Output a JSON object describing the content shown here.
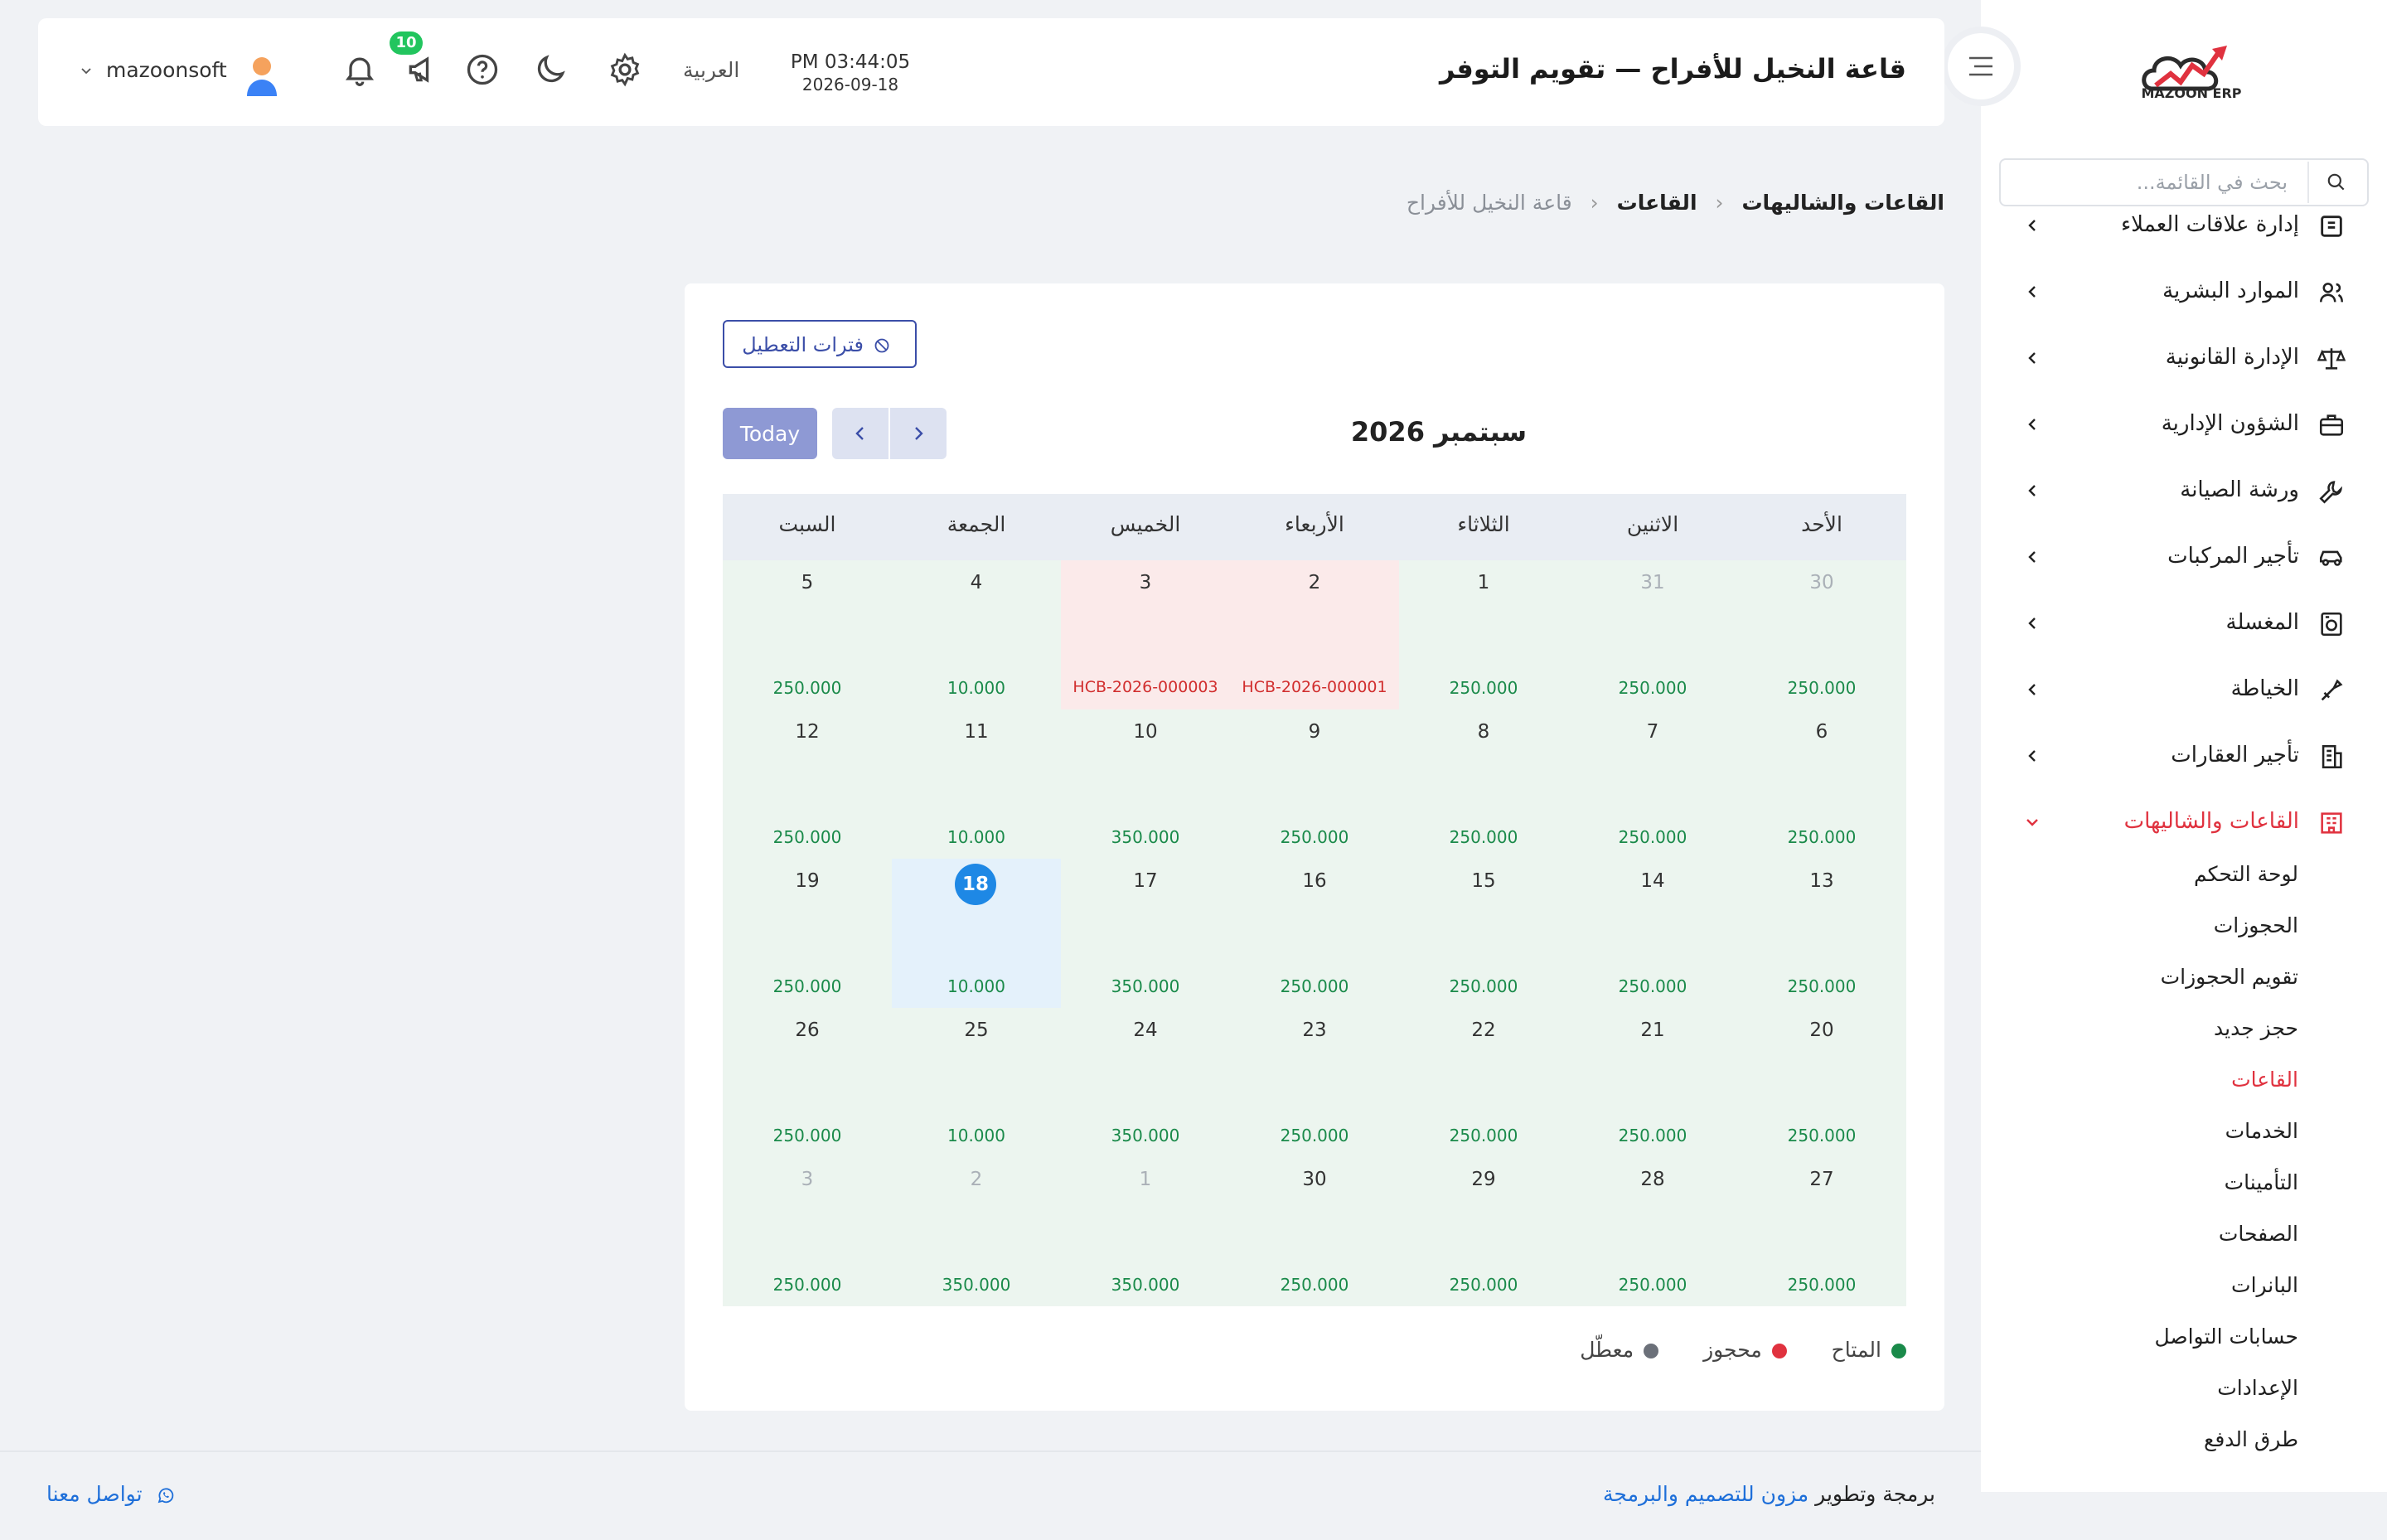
{
  "app": {
    "logo_text": "MAZOON ERP"
  },
  "sidebar": {
    "search_placeholder": "بحث في القائمة...",
    "items": [
      {
        "label": "إدارة علاقات العملاء",
        "icon": "crm-icon"
      },
      {
        "label": "الموارد البشرية",
        "icon": "users-icon"
      },
      {
        "label": "الإدارة القانونية",
        "icon": "scale-icon"
      },
      {
        "label": "الشؤون الإدارية",
        "icon": "briefcase-icon"
      },
      {
        "label": "ورشة الصيانة",
        "icon": "wrench-icon"
      },
      {
        "label": "تأجير المركبات",
        "icon": "car-icon"
      },
      {
        "label": "المغسلة",
        "icon": "laundry-icon"
      },
      {
        "label": "الخياطة",
        "icon": "sewing-icon"
      },
      {
        "label": "تأجير العقارات",
        "icon": "building-icon"
      },
      {
        "label": "القاعات والشاليهات",
        "icon": "hall-icon",
        "active": true
      }
    ],
    "sub_items": [
      {
        "label": "لوحة التحكم"
      },
      {
        "label": "الحجوزات"
      },
      {
        "label": "تقويم الحجوزات"
      },
      {
        "label": "حجز جديد"
      },
      {
        "label": "القاعات",
        "active": true
      },
      {
        "label": "الخدمات"
      },
      {
        "label": "التأمينات"
      },
      {
        "label": "الصفحات"
      },
      {
        "label": "البانرات"
      },
      {
        "label": "حسابات التواصل"
      },
      {
        "label": "الإعدادات"
      },
      {
        "label": "طرق الدفع"
      }
    ]
  },
  "header": {
    "title": "قاعة النخيل للأفراح — تقويم التوفر",
    "time": "PM 03:44:05",
    "date": "2026-09-18",
    "language": "العربية",
    "notification_count": "10",
    "username": "mazoonsoft"
  },
  "breadcrumb": {
    "items": [
      "القاعات والشاليهات",
      "القاعات",
      "قاعة النخيل للأفراح"
    ],
    "separator": "‹"
  },
  "calendar": {
    "disable_periods_label": "فترات التعطيل",
    "today_label": "Today",
    "month_title": "سبتمبر 2026",
    "weekdays": [
      "الأحد",
      "الاثنين",
      "الثلاثاء",
      "الأربعاء",
      "الخميس",
      "الجمعة",
      "السبت"
    ],
    "weeks": [
      [
        {
          "day": "30",
          "price": "250.000",
          "other": true
        },
        {
          "day": "31",
          "price": "250.000",
          "other": true
        },
        {
          "day": "1",
          "price": "250.000"
        },
        {
          "day": "2",
          "price": "HCB-2026-000001",
          "status": "booked"
        },
        {
          "day": "3",
          "price": "HCB-2026-000003",
          "status": "booked"
        },
        {
          "day": "4",
          "price": "10.000"
        },
        {
          "day": "5",
          "price": "250.000"
        }
      ],
      [
        {
          "day": "6",
          "price": "250.000"
        },
        {
          "day": "7",
          "price": "250.000"
        },
        {
          "day": "8",
          "price": "250.000"
        },
        {
          "day": "9",
          "price": "250.000"
        },
        {
          "day": "10",
          "price": "350.000"
        },
        {
          "day": "11",
          "price": "10.000"
        },
        {
          "day": "12",
          "price": "250.000"
        }
      ],
      [
        {
          "day": "13",
          "price": "250.000"
        },
        {
          "day": "14",
          "price": "250.000"
        },
        {
          "day": "15",
          "price": "250.000"
        },
        {
          "day": "16",
          "price": "250.000"
        },
        {
          "day": "17",
          "price": "350.000"
        },
        {
          "day": "18",
          "price": "10.000",
          "today": true
        },
        {
          "day": "19",
          "price": "250.000"
        }
      ],
      [
        {
          "day": "20",
          "price": "250.000"
        },
        {
          "day": "21",
          "price": "250.000"
        },
        {
          "day": "22",
          "price": "250.000"
        },
        {
          "day": "23",
          "price": "250.000"
        },
        {
          "day": "24",
          "price": "350.000"
        },
        {
          "day": "25",
          "price": "10.000"
        },
        {
          "day": "26",
          "price": "250.000"
        }
      ],
      [
        {
          "day": "27",
          "price": "250.000"
        },
        {
          "day": "28",
          "price": "250.000"
        },
        {
          "day": "29",
          "price": "250.000"
        },
        {
          "day": "30",
          "price": "250.000"
        },
        {
          "day": "1",
          "price": "350.000",
          "other": true
        },
        {
          "day": "2",
          "price": "350.000",
          "other": true
        },
        {
          "day": "3",
          "price": "250.000",
          "other": true
        }
      ]
    ],
    "legend": [
      {
        "label": "المتاح",
        "color": "#1a8a4a"
      },
      {
        "label": "محجوز",
        "color": "#e0323f"
      },
      {
        "label": "معطّل",
        "color": "#6b7079"
      }
    ]
  },
  "footer": {
    "credit_prefix": "برمجة وتطوير",
    "credit_link": "مزون للتصميم والبرمجة",
    "contact_label": "تواصل معنا"
  },
  "colors": {
    "accent": "#3b4ea8",
    "active_menu": "#e0323f",
    "available": "#1a8a4a",
    "booked": "#d12e2e",
    "today": "#1e88e5"
  }
}
